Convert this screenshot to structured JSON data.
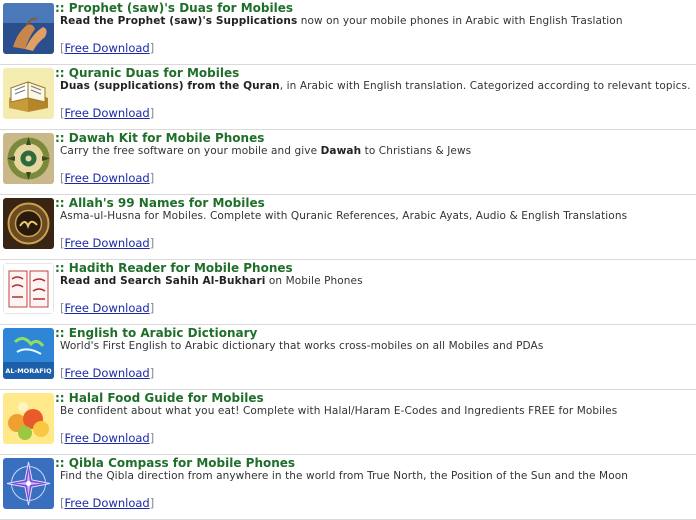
{
  "items": [
    {
      "prefix": ":: ",
      "title": "Prophet (saw)'s Duas for Mobiles",
      "desc_bold": "Read the Prophet (saw)'s Supplications",
      "desc_rest": " now on your mobile phones in Arabic with English Traslation",
      "link_open": "[",
      "link": "Free Download",
      "link_close": "]",
      "icon": "praying-hands-icon"
    },
    {
      "prefix": ":: ",
      "title": "Quranic Duas for Mobiles",
      "desc_bold": "Duas (supplications) from the Quran",
      "desc_rest": ", in Arabic with English translation. Categorized according to relevant topics.",
      "link_open": "[",
      "link": "Free Download",
      "link_close": "]",
      "icon": "quran-stand-icon"
    },
    {
      "prefix": ":: ",
      "title": "Dawah Kit for Mobile Phones",
      "desc_pre": "Carry the free software on your mobile and give ",
      "desc_bold": "Dawah",
      "desc_rest": " to Christians & Jews",
      "link_open": "[",
      "link": "Free Download",
      "link_close": "]",
      "icon": "ornament-medallion-icon"
    },
    {
      "prefix": ":: ",
      "title": "Allah's 99 Names for Mobiles",
      "desc_rest": "Asma-ul-Husna for Mobiles. Complete with Quranic References, Arabic Ayats, Audio & English Translations",
      "link_open": "[",
      "link": "Free Download",
      "link_close": "]",
      "icon": "calligraphy-medallion-icon"
    },
    {
      "prefix": ":: ",
      "title": "Hadith Reader for Mobile Phones",
      "desc_bold": "Read and Search Sahih Al-Bukhari",
      "desc_rest": " on Mobile Phones",
      "link_open": "[",
      "link": "Free Download",
      "link_close": "]",
      "icon": "hadith-book-icon"
    },
    {
      "prefix": ":: ",
      "title": "English to Arabic Dictionary",
      "desc_rest": "World's First English to Arabic dictionary that works cross-mobiles on all Mobiles and PDAs",
      "link_open": "[",
      "link": "Free Download",
      "link_close": "]",
      "icon": "al-morafiq-logo-icon",
      "logo_text": "AL-MORAFIQ"
    },
    {
      "prefix": ":: ",
      "title": "Halal Food Guide for Mobiles",
      "desc_rest": "Be confident about what you eat! Complete with Halal/Haram E-Codes and Ingredients FREE for Mobiles",
      "link_open": "[",
      "link": "Free Download",
      "link_close": "]",
      "icon": "food-basket-icon"
    },
    {
      "prefix": ":: ",
      "title": "Qibla Compass for Mobile Phones",
      "desc_rest": "Find the Qibla direction from anywhere in the world from True North, the Position of the Sun and the Moon",
      "link_open": "[",
      "link": "Free Download",
      "link_close": "]",
      "icon": "compass-rose-icon"
    }
  ]
}
